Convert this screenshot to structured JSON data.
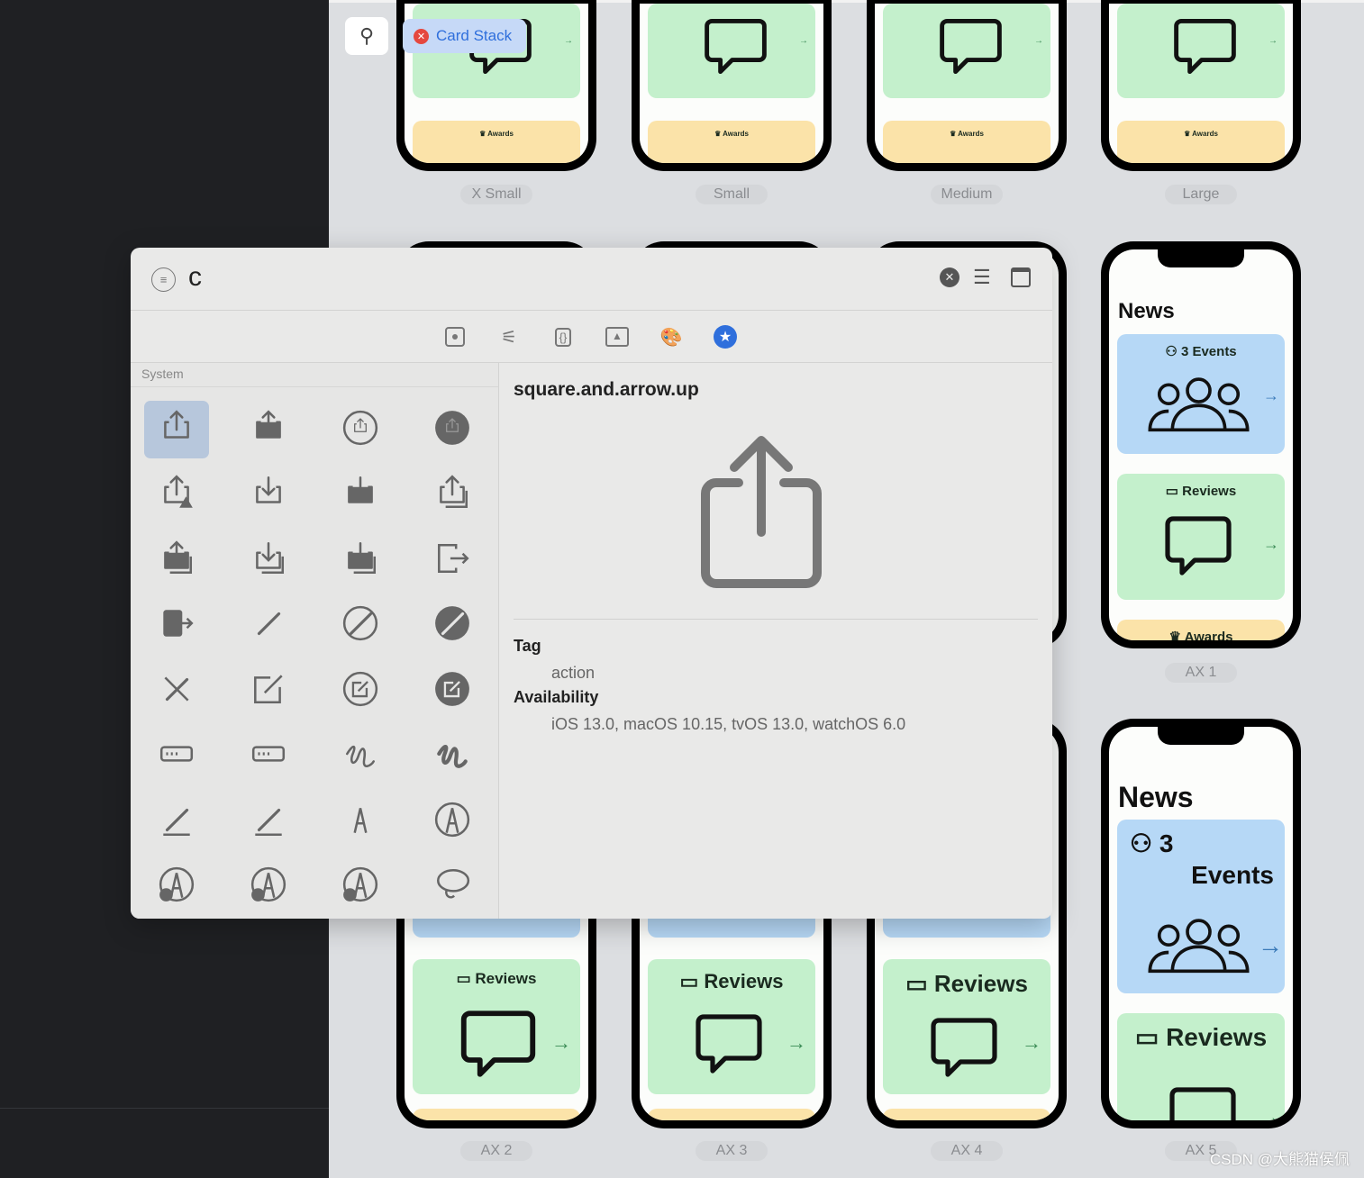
{
  "pin_icon": "pin-icon",
  "tag": {
    "label": "Card Stack",
    "close_icon": "xmark-circle-fill"
  },
  "previews": {
    "labels": [
      "X Small",
      "Small",
      "Medium",
      "Large",
      "AX 1",
      "AX 2",
      "AX 3",
      "AX 4",
      "AX 5"
    ],
    "news_title": "News",
    "events_label": "3 Events",
    "events_label_a": "3",
    "events_label_b": "Events",
    "reviews_label": "Reviews",
    "awards_label": "Awards"
  },
  "popup": {
    "search": {
      "value": "c",
      "filter_icon": "line.3.horizontal.decrease.circle",
      "clear_icon": "xmark.circle.fill",
      "list_icon": "list.bullet",
      "window_icon": "sidebar"
    },
    "toolbar": [
      "square.dot",
      "slider.horizontal",
      "curlybraces.square",
      "photo",
      "paintpalette",
      "star.circle.fill"
    ],
    "section_label": "System",
    "symbols": [
      "square.and.arrow.up",
      "square.and.arrow.up.fill",
      "square.and.arrow.up.circle",
      "square.and.arrow.up.circle.fill",
      "square.and.arrow.up.trianglebadge.exclamationmark",
      "square.and.arrow.down",
      "square.and.arrow.down.fill",
      "square.and.arrow.up.on.square",
      "square.and.arrow.up.on.square.fill",
      "square.and.arrow.down.on.square",
      "square.and.arrow.down.on.square.fill",
      "rectangle.portrait.and.arrow.right",
      "rectangle.portrait.and.arrow.right.fill",
      "pencil",
      "pencil.circle",
      "pencil.circle.fill",
      "pencil.slash",
      "square.and.pencil",
      "square.and.pencil.circle",
      "square.and.pencil.circle.fill",
      "rectangle.and.pencil.and.ellipsis",
      "ellipsis.rectangle",
      "scribble",
      "scribble.variable",
      "pencil.line",
      "pencil.and.outline",
      "pencil.tip",
      "pencil.tip.crop.circle",
      "pencil.tip.crop.circle.badge.plus",
      "pencil.tip.crop.circle.badge.minus",
      "pencil.tip.crop.circle.badge.arrow.forward",
      "lasso"
    ],
    "selected": {
      "name": "square.and.arrow.up",
      "tag_heading": "Tag",
      "tag": "action",
      "availability_heading": "Availability",
      "availability": "iOS 13.0, macOS 10.15, tvOS 13.0, watchOS 6.0"
    }
  },
  "watermark": "CSDN @大熊猫侯佩",
  "colors": {
    "accent": "#2f6fdc",
    "card_green": "#c4f0cc",
    "card_blue": "#b6d8f6",
    "card_yellow": "#fbe3a9",
    "selection": "#b7c7dc"
  }
}
